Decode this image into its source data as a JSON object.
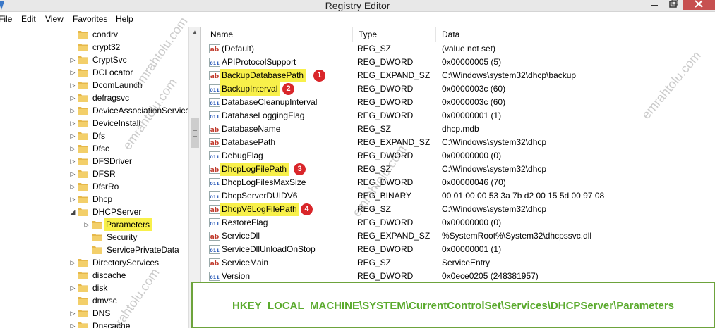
{
  "window": {
    "title": "Registry Editor"
  },
  "menu": [
    "File",
    "Edit",
    "View",
    "Favorites",
    "Help"
  ],
  "tree": {
    "items": [
      {
        "label": "condrv",
        "expander": ""
      },
      {
        "label": "crypt32",
        "expander": ""
      },
      {
        "label": "CryptSvc",
        "expander": "▷"
      },
      {
        "label": "DCLocator",
        "expander": "▷"
      },
      {
        "label": "DcomLaunch",
        "expander": "▷"
      },
      {
        "label": "defragsvc",
        "expander": "▷"
      },
      {
        "label": "DeviceAssociationService",
        "expander": "▷"
      },
      {
        "label": "DeviceInstall",
        "expander": "▷"
      },
      {
        "label": "Dfs",
        "expander": "▷"
      },
      {
        "label": "Dfsc",
        "expander": "▷"
      },
      {
        "label": "DFSDriver",
        "expander": "▷"
      },
      {
        "label": "DFSR",
        "expander": "▷"
      },
      {
        "label": "DfsrRo",
        "expander": "▷"
      },
      {
        "label": "Dhcp",
        "expander": "▷"
      },
      {
        "label": "DHCPServer",
        "expander": "◢"
      },
      {
        "label": "Parameters",
        "expander": "▷"
      },
      {
        "label": "Security",
        "expander": ""
      },
      {
        "label": "ServicePrivateData",
        "expander": ""
      },
      {
        "label": "DirectoryServices",
        "expander": "▷"
      },
      {
        "label": "discache",
        "expander": ""
      },
      {
        "label": "disk",
        "expander": "▷"
      },
      {
        "label": "dmvsc",
        "expander": ""
      },
      {
        "label": "DNS",
        "expander": "▷"
      },
      {
        "label": "Dnscache",
        "expander": "▷"
      }
    ]
  },
  "list": {
    "columns": [
      "Name",
      "Type",
      "Data"
    ],
    "rows": [
      {
        "icon": "string-value-icon",
        "name": "(Default)",
        "type": "REG_SZ",
        "data": "(value not set)"
      },
      {
        "icon": "binary-value-icon",
        "name": "APIProtocolSupport",
        "type": "REG_DWORD",
        "data": "0x00000005 (5)"
      },
      {
        "icon": "string-value-icon",
        "name": "BackupDatabasePath",
        "type": "REG_EXPAND_SZ",
        "data": "C:\\Windows\\system32\\dhcp\\backup",
        "badge": "1"
      },
      {
        "icon": "binary-value-icon",
        "name": "BackupInterval",
        "type": "REG_DWORD",
        "data": "0x0000003c (60)",
        "badge": "2"
      },
      {
        "icon": "binary-value-icon",
        "name": "DatabaseCleanupInterval",
        "type": "REG_DWORD",
        "data": "0x0000003c (60)"
      },
      {
        "icon": "binary-value-icon",
        "name": "DatabaseLoggingFlag",
        "type": "REG_DWORD",
        "data": "0x00000001 (1)"
      },
      {
        "icon": "string-value-icon",
        "name": "DatabaseName",
        "type": "REG_SZ",
        "data": "dhcp.mdb"
      },
      {
        "icon": "string-value-icon",
        "name": "DatabasePath",
        "type": "REG_EXPAND_SZ",
        "data": "C:\\Windows\\system32\\dhcp"
      },
      {
        "icon": "binary-value-icon",
        "name": "DebugFlag",
        "type": "REG_DWORD",
        "data": "0x00000000 (0)"
      },
      {
        "icon": "string-value-icon",
        "name": "DhcpLogFilePath",
        "type": "REG_SZ",
        "data": "C:\\Windows\\system32\\dhcp",
        "badge": "3"
      },
      {
        "icon": "binary-value-icon",
        "name": "DhcpLogFilesMaxSize",
        "type": "REG_DWORD",
        "data": "0x00000046 (70)"
      },
      {
        "icon": "binary-value-icon",
        "name": "DhcpServerDUIDV6",
        "type": "REG_BINARY",
        "data": "00 01 00 00 53 3a 7b d2 00 15 5d 00 97 08"
      },
      {
        "icon": "string-value-icon",
        "name": "DhcpV6LogFilePath",
        "type": "REG_SZ",
        "data": "C:\\Windows\\system32\\dhcp",
        "badge": "4"
      },
      {
        "icon": "binary-value-icon",
        "name": "RestoreFlag",
        "type": "REG_DWORD",
        "data": "0x00000000 (0)"
      },
      {
        "icon": "string-value-icon",
        "name": "ServiceDll",
        "type": "REG_EXPAND_SZ",
        "data": "%SystemRoot%\\System32\\dhcpssvc.dll"
      },
      {
        "icon": "binary-value-icon",
        "name": "ServiceDllUnloadOnStop",
        "type": "REG_DWORD",
        "data": "0x00000001 (1)"
      },
      {
        "icon": "string-value-icon",
        "name": "ServiceMain",
        "type": "REG_SZ",
        "data": "ServiceEntry"
      },
      {
        "icon": "binary-value-icon",
        "name": "Version",
        "type": "REG_DWORD",
        "data": "0x0ece0205 (248381957)"
      }
    ]
  },
  "path_banner": "HKEY_LOCAL_MACHINE\\SYSTEM\\CurrentControlSet\\Services\\DHCPServer\\Parameters",
  "watermark": "emrahtolu.com",
  "colors": {
    "highlight": "#f8f04a",
    "badge": "#d9262a",
    "path_green": "#5aaa2d",
    "folder": "#e6b84a"
  }
}
